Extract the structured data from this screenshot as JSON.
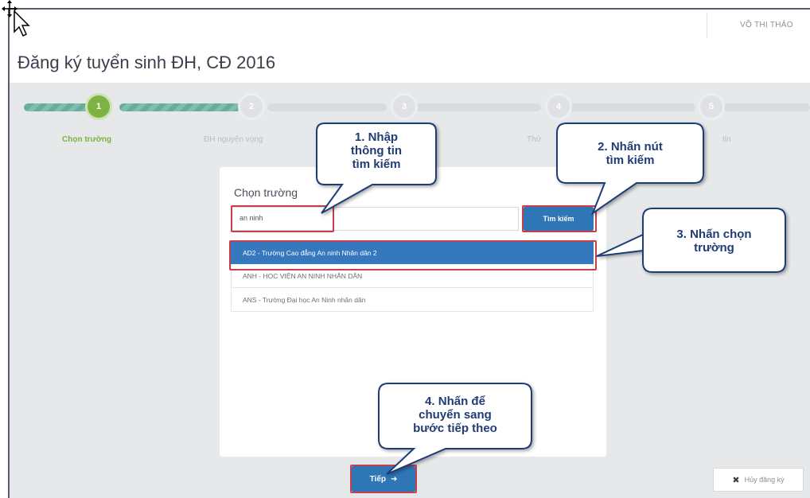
{
  "header": {
    "user_name": "VÕ THỊ THẢO",
    "page_title": "Đăng ký tuyển sinh ĐH, CĐ 2016"
  },
  "stepper": {
    "steps": [
      {
        "number": "1",
        "label": "Chọn trường"
      },
      {
        "number": "2",
        "label": "ĐH nguyện vọng"
      },
      {
        "number": "3",
        "label": ""
      },
      {
        "number": "4",
        "label": "Thứ"
      },
      {
        "number": "5",
        "label": "tin"
      }
    ]
  },
  "school_picker": {
    "label": "Chọn trường",
    "search_value": "an ninh",
    "search_button": "Tìm kiếm",
    "results": [
      "AD2 - Trường Cao đẳng An ninh Nhân dân 2",
      "ANH - HỌC VIỆN AN NINH NHÂN DÂN",
      "ANS - Trường Đại học An Ninh nhân dân"
    ]
  },
  "actions": {
    "next_label": "Tiếp",
    "next_icon": "arrow-right-icon",
    "cancel_label": "Hủy đăng ký",
    "cancel_icon": "close-icon"
  },
  "callouts": {
    "c1": [
      "1. Nhập",
      "thông tin",
      "tìm kiếm"
    ],
    "c2": [
      "2. Nhấn nút",
      "tìm kiếm"
    ],
    "c3": [
      "3. Nhấn chọn",
      "trường"
    ],
    "c4": [
      "4. Nhấn để",
      "chuyển sang",
      "bước tiếp theo"
    ]
  },
  "colors": {
    "accent_blue": "#2f76b6",
    "step_active": "#7cb342",
    "highlight_red": "#c5404a",
    "callout_text": "#1f3c74"
  }
}
